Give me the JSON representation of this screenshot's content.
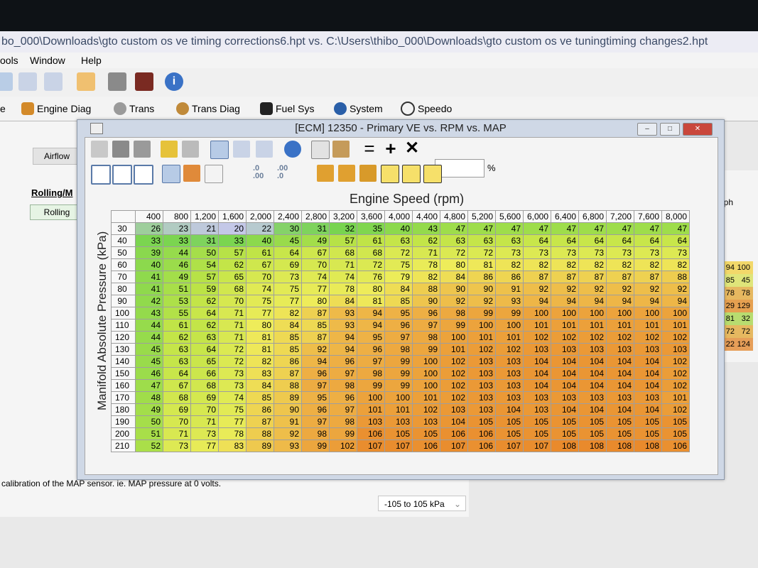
{
  "window_title": "bo_000\\Downloads\\gto custom os ve timing corrections6.hpt vs. C:\\Users\\thibo_000\\Downloads\\gto custom os ve tuningtiming changes2.hpt",
  "menu": [
    "ools",
    "Window",
    "Help"
  ],
  "toolbar2": [
    {
      "label": "e",
      "icon": "engine-icon"
    },
    {
      "label": "Engine Diag",
      "icon": "engine-diag-icon"
    },
    {
      "label": "Trans",
      "icon": "gear-icon"
    },
    {
      "label": "Trans Diag",
      "icon": "gear-icon"
    },
    {
      "label": "Fuel Sys",
      "icon": "fuel-pump-icon"
    },
    {
      "label": "System",
      "icon": "system-icon"
    },
    {
      "label": "Speedo",
      "icon": "speedometer-icon"
    }
  ],
  "left_pane": {
    "tab": "Airflow",
    "heading": "Rolling/M",
    "button": "Rolling"
  },
  "bottom_pane": {
    "description": "calibration of the MAP sensor. ie. MAP pressure at 0 volts.",
    "range": "-105 to 105 kPa"
  },
  "right_pane": {
    "label": "nph",
    "rows": [
      [
        "94",
        "100"
      ],
      [
        "85",
        "45"
      ],
      [
        "78",
        "78"
      ],
      [
        "29",
        "129"
      ],
      [
        "81",
        "32"
      ],
      [
        "72",
        "72"
      ],
      [
        "22",
        "124"
      ]
    ]
  },
  "ve_window": {
    "title": "[ECM] 12350 - Primary VE vs. RPM vs. MAP",
    "pct_label": "%",
    "fmt_dec": ".0",
    "fmt_dec2": ".00",
    "fmt_dec3": ".00",
    "fmt_dec4": ".0",
    "x_title": "Engine Speed (rpm)",
    "y_title": "Manifold Absolute Pressure (kPa)",
    "columns": [
      "400",
      "800",
      "1,200",
      "1,600",
      "2,000",
      "2,400",
      "2,800",
      "3,200",
      "3,600",
      "4,000",
      "4,400",
      "4,800",
      "5,200",
      "5,600",
      "6,000",
      "6,400",
      "6,800",
      "7,200",
      "7,600",
      "8,000"
    ],
    "rows": [
      {
        "kpa": "30",
        "v": [
          26,
          23,
          21,
          20,
          22,
          30,
          31,
          32,
          35,
          40,
          43,
          47,
          47,
          47,
          47,
          47,
          47,
          47,
          47,
          47
        ]
      },
      {
        "kpa": "40",
        "v": [
          33,
          33,
          31,
          33,
          40,
          45,
          49,
          57,
          61,
          63,
          62,
          63,
          63,
          63,
          64,
          64,
          64,
          64,
          64,
          64
        ]
      },
      {
        "kpa": "50",
        "v": [
          39,
          44,
          50,
          57,
          61,
          64,
          67,
          68,
          68,
          72,
          71,
          72,
          72,
          73,
          73,
          73,
          73,
          73,
          73,
          73
        ]
      },
      {
        "kpa": "60",
        "v": [
          40,
          46,
          54,
          62,
          67,
          69,
          70,
          71,
          72,
          75,
          78,
          80,
          81,
          82,
          82,
          82,
          82,
          82,
          82,
          82
        ]
      },
      {
        "kpa": "70",
        "v": [
          41,
          49,
          57,
          65,
          70,
          73,
          74,
          74,
          76,
          79,
          82,
          84,
          86,
          86,
          87,
          87,
          87,
          87,
          87,
          88
        ]
      },
      {
        "kpa": "80",
        "v": [
          41,
          51,
          59,
          68,
          74,
          75,
          77,
          78,
          80,
          84,
          88,
          90,
          90,
          91,
          92,
          92,
          92,
          92,
          92,
          92
        ]
      },
      {
        "kpa": "90",
        "v": [
          42,
          53,
          62,
          70,
          75,
          77,
          80,
          84,
          81,
          85,
          90,
          92,
          92,
          93,
          94,
          94,
          94,
          94,
          94,
          94
        ]
      },
      {
        "kpa": "100",
        "v": [
          43,
          55,
          64,
          71,
          77,
          82,
          87,
          93,
          94,
          95,
          96,
          98,
          99,
          99,
          100,
          100,
          100,
          100,
          100,
          100
        ]
      },
      {
        "kpa": "110",
        "v": [
          44,
          61,
          62,
          71,
          80,
          84,
          85,
          93,
          94,
          96,
          97,
          99,
          100,
          100,
          101,
          101,
          101,
          101,
          101,
          101
        ]
      },
      {
        "kpa": "120",
        "v": [
          44,
          62,
          63,
          71,
          81,
          85,
          87,
          94,
          95,
          97,
          98,
          100,
          101,
          101,
          102,
          102,
          102,
          102,
          102,
          102
        ]
      },
      {
        "kpa": "130",
        "v": [
          45,
          63,
          64,
          72,
          81,
          85,
          92,
          94,
          96,
          98,
          99,
          101,
          102,
          102,
          103,
          103,
          103,
          103,
          103,
          103
        ]
      },
      {
        "kpa": "140",
        "v": [
          45,
          63,
          65,
          72,
          82,
          86,
          94,
          96,
          97,
          99,
          100,
          102,
          103,
          103,
          104,
          104,
          104,
          104,
          104,
          102
        ]
      },
      {
        "kpa": "150",
        "v": [
          46,
          64,
          66,
          73,
          83,
          87,
          96,
          97,
          98,
          99,
          100,
          102,
          103,
          103,
          104,
          104,
          104,
          104,
          104,
          102
        ]
      },
      {
        "kpa": "160",
        "v": [
          47,
          67,
          68,
          73,
          84,
          88,
          97,
          98,
          99,
          99,
          100,
          102,
          103,
          103,
          104,
          104,
          104,
          104,
          104,
          102
        ]
      },
      {
        "kpa": "170",
        "v": [
          48,
          68,
          69,
          74,
          85,
          89,
          95,
          96,
          100,
          100,
          101,
          102,
          103,
          103,
          103,
          103,
          103,
          103,
          103,
          101
        ]
      },
      {
        "kpa": "180",
        "v": [
          49,
          69,
          70,
          75,
          86,
          90,
          96,
          97,
          101,
          101,
          102,
          103,
          103,
          104,
          103,
          104,
          104,
          104,
          104,
          102
        ]
      },
      {
        "kpa": "190",
        "v": [
          50,
          70,
          71,
          77,
          87,
          91,
          97,
          98,
          103,
          103,
          103,
          104,
          105,
          105,
          105,
          105,
          105,
          105,
          105,
          105
        ]
      },
      {
        "kpa": "200",
        "v": [
          51,
          71,
          73,
          78,
          88,
          92,
          98,
          99,
          106,
          105,
          105,
          106,
          106,
          105,
          105,
          105,
          105,
          105,
          105,
          105
        ]
      },
      {
        "kpa": "210",
        "v": [
          52,
          73,
          77,
          83,
          89,
          93,
          99,
          102,
          107,
          107,
          106,
          107,
          106,
          107,
          107,
          108,
          108,
          108,
          108,
          106
        ]
      }
    ]
  }
}
